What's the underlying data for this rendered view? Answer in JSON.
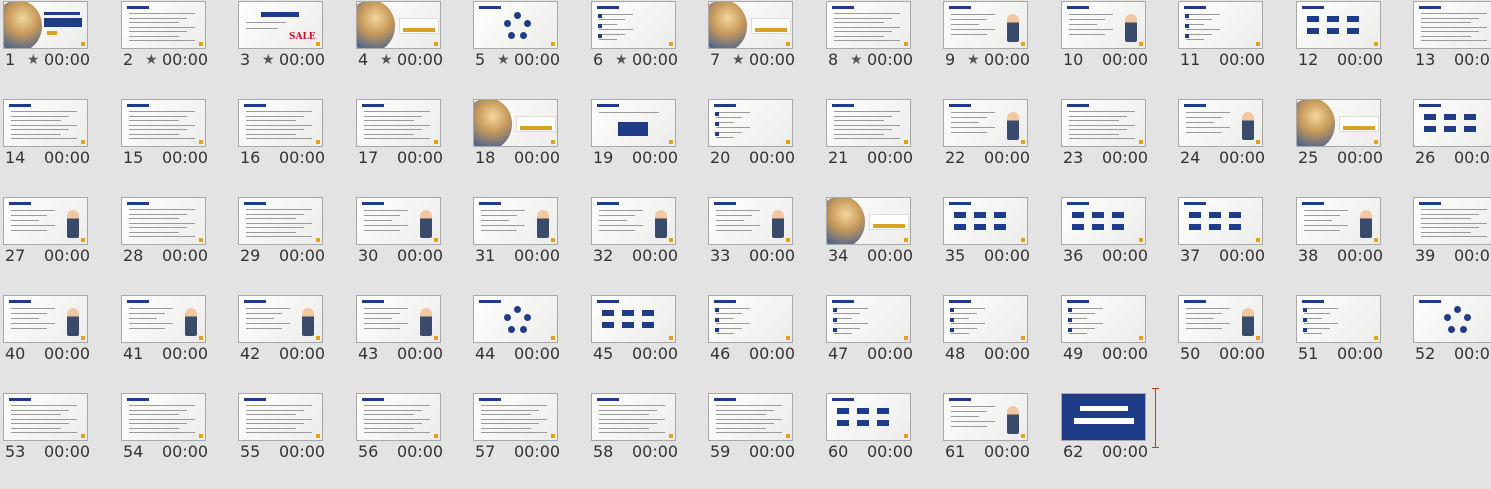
{
  "slide_sorter": {
    "slides": [
      {
        "number": "1",
        "star": "★",
        "duration": "00:00",
        "thumb": "title"
      },
      {
        "number": "2",
        "star": "★",
        "duration": "00:00",
        "thumb": "text"
      },
      {
        "number": "3",
        "star": "★",
        "duration": "00:00",
        "thumb": "sale",
        "sale_text": "SALE"
      },
      {
        "number": "4",
        "star": "★",
        "duration": "00:00",
        "thumb": "section"
      },
      {
        "number": "5",
        "star": "★",
        "duration": "00:00",
        "thumb": "diagram"
      },
      {
        "number": "6",
        "star": "★",
        "duration": "00:00",
        "thumb": "list"
      },
      {
        "number": "7",
        "star": "★",
        "duration": "00:00",
        "thumb": "section"
      },
      {
        "number": "8",
        "star": "★",
        "duration": "00:00",
        "thumb": "text"
      },
      {
        "number": "9",
        "star": "★",
        "duration": "00:00",
        "thumb": "figure"
      },
      {
        "number": "10",
        "star": "",
        "duration": "00:00",
        "thumb": "figure"
      },
      {
        "number": "11",
        "star": "",
        "duration": "00:00",
        "thumb": "list"
      },
      {
        "number": "12",
        "star": "",
        "duration": "00:00",
        "thumb": "boxes"
      },
      {
        "number": "13",
        "star": "",
        "duration": "00:00",
        "thumb": "text"
      },
      {
        "number": "14",
        "star": "",
        "duration": "00:00",
        "thumb": "text"
      },
      {
        "number": "15",
        "star": "",
        "duration": "00:00",
        "thumb": "text"
      },
      {
        "number": "16",
        "star": "",
        "duration": "00:00",
        "thumb": "text"
      },
      {
        "number": "17",
        "star": "",
        "duration": "00:00",
        "thumb": "text"
      },
      {
        "number": "18",
        "star": "",
        "duration": "00:00",
        "thumb": "section"
      },
      {
        "number": "19",
        "star": "",
        "duration": "00:00",
        "thumb": "navy"
      },
      {
        "number": "20",
        "star": "",
        "duration": "00:00",
        "thumb": "list"
      },
      {
        "number": "21",
        "star": "",
        "duration": "00:00",
        "thumb": "text"
      },
      {
        "number": "22",
        "star": "",
        "duration": "00:00",
        "thumb": "figure"
      },
      {
        "number": "23",
        "star": "",
        "duration": "00:00",
        "thumb": "text"
      },
      {
        "number": "24",
        "star": "",
        "duration": "00:00",
        "thumb": "figure"
      },
      {
        "number": "25",
        "star": "",
        "duration": "00:00",
        "thumb": "section"
      },
      {
        "number": "26",
        "star": "",
        "duration": "00:00",
        "thumb": "boxes"
      },
      {
        "number": "27",
        "star": "",
        "duration": "00:00",
        "thumb": "figure"
      },
      {
        "number": "28",
        "star": "",
        "duration": "00:00",
        "thumb": "text"
      },
      {
        "number": "29",
        "star": "",
        "duration": "00:00",
        "thumb": "text"
      },
      {
        "number": "30",
        "star": "",
        "duration": "00:00",
        "thumb": "figure"
      },
      {
        "number": "31",
        "star": "",
        "duration": "00:00",
        "thumb": "figure"
      },
      {
        "number": "32",
        "star": "",
        "duration": "00:00",
        "thumb": "figure"
      },
      {
        "number": "33",
        "star": "",
        "duration": "00:00",
        "thumb": "figure"
      },
      {
        "number": "34",
        "star": "",
        "duration": "00:00",
        "thumb": "section"
      },
      {
        "number": "35",
        "star": "",
        "duration": "00:00",
        "thumb": "boxes"
      },
      {
        "number": "36",
        "star": "",
        "duration": "00:00",
        "thumb": "boxes"
      },
      {
        "number": "37",
        "star": "",
        "duration": "00:00",
        "thumb": "boxes"
      },
      {
        "number": "38",
        "star": "",
        "duration": "00:00",
        "thumb": "figure"
      },
      {
        "number": "39",
        "star": "",
        "duration": "00:00",
        "thumb": "text"
      },
      {
        "number": "40",
        "star": "",
        "duration": "00:00",
        "thumb": "figure"
      },
      {
        "number": "41",
        "star": "",
        "duration": "00:00",
        "thumb": "figure"
      },
      {
        "number": "42",
        "star": "",
        "duration": "00:00",
        "thumb": "figure"
      },
      {
        "number": "43",
        "star": "",
        "duration": "00:00",
        "thumb": "figure"
      },
      {
        "number": "44",
        "star": "",
        "duration": "00:00",
        "thumb": "diagram"
      },
      {
        "number": "45",
        "star": "",
        "duration": "00:00",
        "thumb": "boxes"
      },
      {
        "number": "46",
        "star": "",
        "duration": "00:00",
        "thumb": "list"
      },
      {
        "number": "47",
        "star": "",
        "duration": "00:00",
        "thumb": "list"
      },
      {
        "number": "48",
        "star": "",
        "duration": "00:00",
        "thumb": "list"
      },
      {
        "number": "49",
        "star": "",
        "duration": "00:00",
        "thumb": "list"
      },
      {
        "number": "50",
        "star": "",
        "duration": "00:00",
        "thumb": "figure"
      },
      {
        "number": "51",
        "star": "",
        "duration": "00:00",
        "thumb": "list"
      },
      {
        "number": "52",
        "star": "",
        "duration": "00:00",
        "thumb": "diagram"
      },
      {
        "number": "53",
        "star": "",
        "duration": "00:00",
        "thumb": "text"
      },
      {
        "number": "54",
        "star": "",
        "duration": "00:00",
        "thumb": "text"
      },
      {
        "number": "55",
        "star": "",
        "duration": "00:00",
        "thumb": "text"
      },
      {
        "number": "56",
        "star": "",
        "duration": "00:00",
        "thumb": "text"
      },
      {
        "number": "57",
        "star": "",
        "duration": "00:00",
        "thumb": "text"
      },
      {
        "number": "58",
        "star": "",
        "duration": "00:00",
        "thumb": "text"
      },
      {
        "number": "59",
        "star": "",
        "duration": "00:00",
        "thumb": "text"
      },
      {
        "number": "60",
        "star": "",
        "duration": "00:00",
        "thumb": "boxes"
      },
      {
        "number": "61",
        "star": "",
        "duration": "00:00",
        "thumb": "figure"
      },
      {
        "number": "62",
        "star": "",
        "duration": "00:00",
        "thumb": "final"
      }
    ]
  },
  "colors": {
    "background": "#e3e3e3",
    "accent_navy": "#1f3c88",
    "accent_gold": "#d7a320",
    "cursor_red": "#c0392b"
  },
  "icons": {
    "star": "star-icon"
  }
}
